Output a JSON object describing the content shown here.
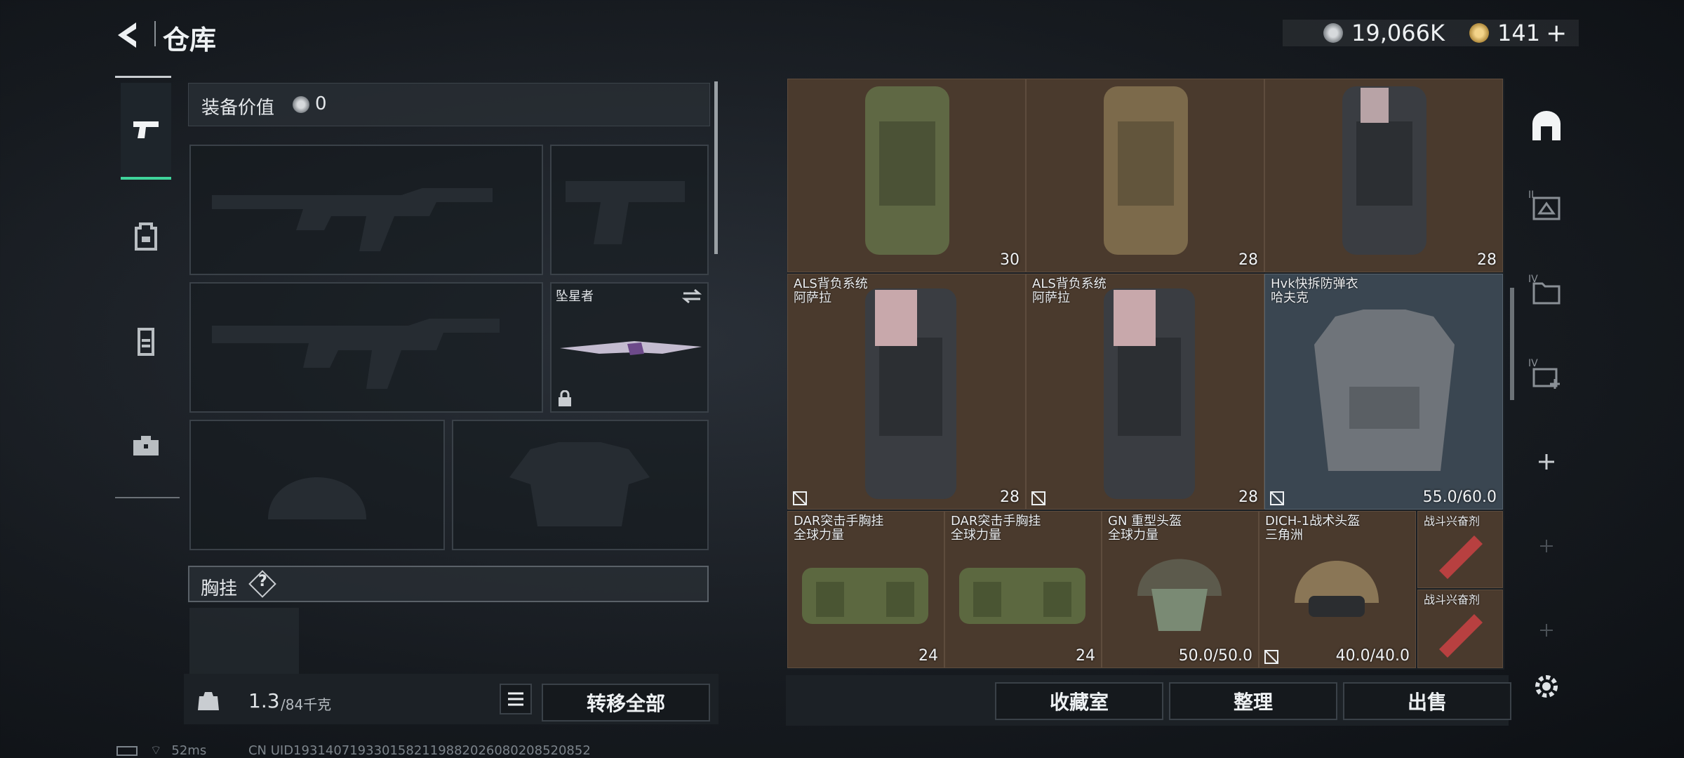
{
  "header": {
    "title": "仓库",
    "currency1": "19,066K",
    "currency2": "141",
    "add_symbol": "+"
  },
  "colors": {
    "accent_green": "#3fd49b",
    "cell_brown": "#4a3a2d",
    "cell_selected": "#3a4651"
  },
  "loadout": {
    "value_label": "装备价值",
    "value": "0",
    "melee_name": "坠星者",
    "chest_label": "胸挂",
    "help_symbol": "?"
  },
  "footer": {
    "weight": "1.3",
    "capacity": "/84千克",
    "transfer_all": "转移全部",
    "collection": "收藏室",
    "sort": "整理",
    "sell": "出售"
  },
  "stash": {
    "items": [
      {
        "name": "",
        "subname": "",
        "count": "30"
      },
      {
        "name": "",
        "subname": "",
        "count": "28"
      },
      {
        "name": "",
        "subname": "",
        "count": "28"
      },
      {
        "name": "ALS背负系统",
        "subname": "阿萨拉",
        "count": "28"
      },
      {
        "name": "ALS背负系统",
        "subname": "阿萨拉",
        "count": "28"
      },
      {
        "name": "Hvk快拆防弹衣",
        "subname": "哈夫克",
        "count": "55.0/60.0"
      },
      {
        "name": "DAR突击手胸挂",
        "subname": "全球力量",
        "count": "24"
      },
      {
        "name": "DAR突击手胸挂",
        "subname": "全球力量",
        "count": "24"
      },
      {
        "name": "GN 重型头盔",
        "subname": "全球力量",
        "count": "50.0/50.0"
      },
      {
        "name": "DICH-1战术头盔",
        "subname": "三角洲",
        "count": "40.0/40.0"
      },
      {
        "name": "战斗兴奋剂",
        "subname": "",
        "count": ""
      },
      {
        "name": "战斗兴奋剂",
        "subname": "",
        "count": ""
      }
    ]
  },
  "side_tabs": {
    "tab2": "II",
    "tab3": "IV",
    "tab4": "IV"
  },
  "status": {
    "ping": "52ms",
    "uid": "CN UID1931407193301582119882026080208520852"
  }
}
